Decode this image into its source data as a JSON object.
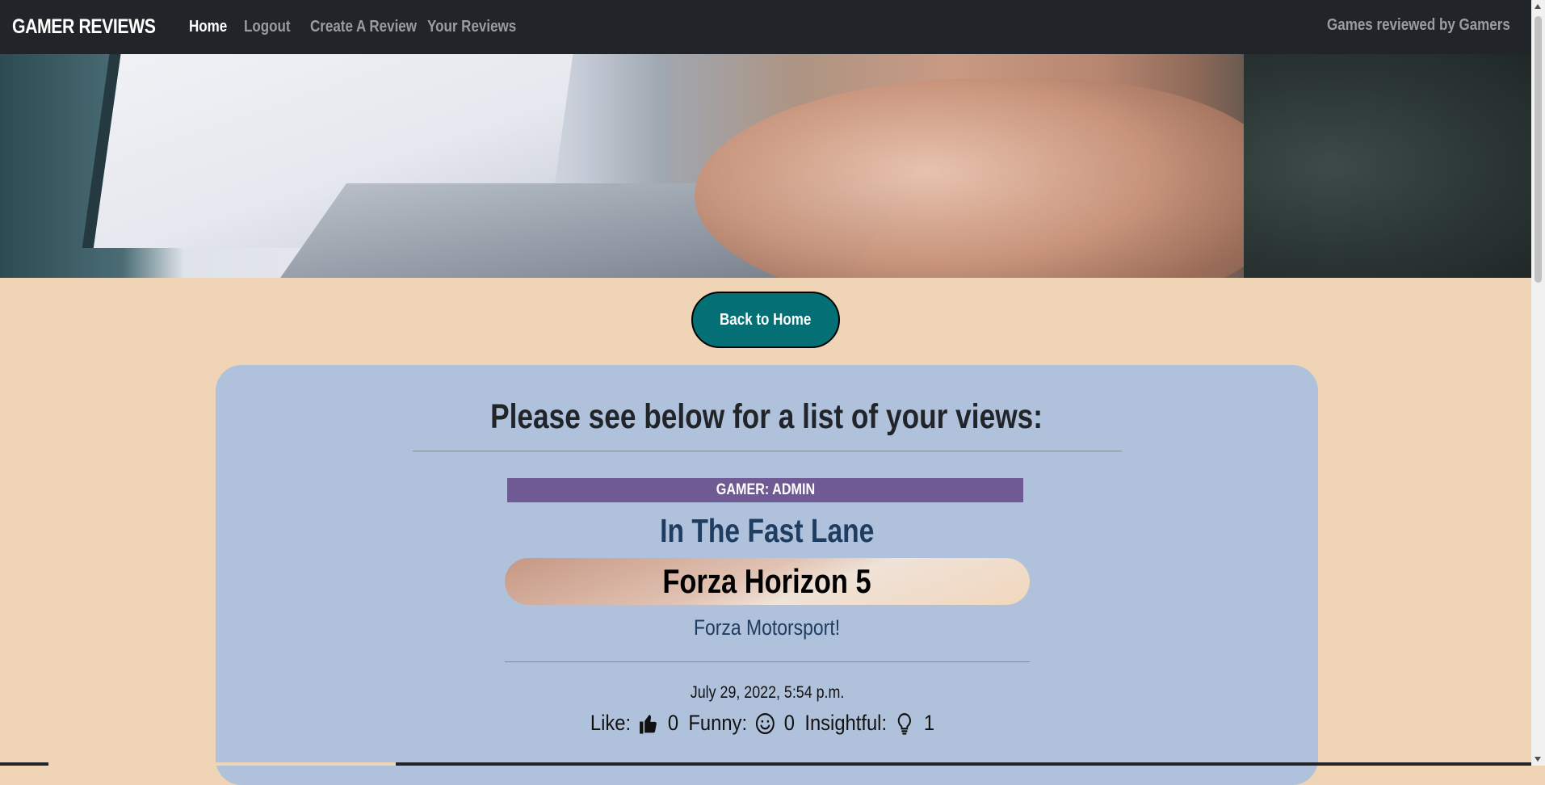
{
  "navbar": {
    "brand": "GAMER REVIEWS",
    "links": [
      {
        "label": "Home",
        "active": true
      },
      {
        "label": "Logout",
        "active": false
      },
      {
        "label": "Create A Review",
        "active": false
      },
      {
        "label": "Your Reviews",
        "active": false
      }
    ],
    "tagline": "Games reviewed by Gamers"
  },
  "hero": {
    "description": ""
  },
  "back_button": {
    "label": "Back to Home"
  },
  "card": {
    "heading": "Please see below for a list of your views:",
    "review": {
      "gamer_label": "GAMER: ADMIN",
      "title": "In The Fast Lane",
      "game": "Forza Horizon 5",
      "subtitle": "Forza Motorsport!",
      "date": "July 29, 2022, 5:54 p.m.",
      "reactions": {
        "like_label": "Like:",
        "like_count": "0",
        "funny_label": "Funny:",
        "funny_count": "0",
        "insightful_label": "Insightful:",
        "insightful_count": "1"
      }
    }
  },
  "colors": {
    "navbar_bg": "#212529",
    "page_bg": "#efd4b6",
    "card_bg": "#b0c1dc",
    "button_bg": "#047075",
    "badge_bg": "#6f5a94",
    "title_color": "#1e3d61"
  },
  "icons": {
    "like": "thumbs-up-icon",
    "funny": "smile-icon",
    "insightful": "lightbulb-icon"
  }
}
